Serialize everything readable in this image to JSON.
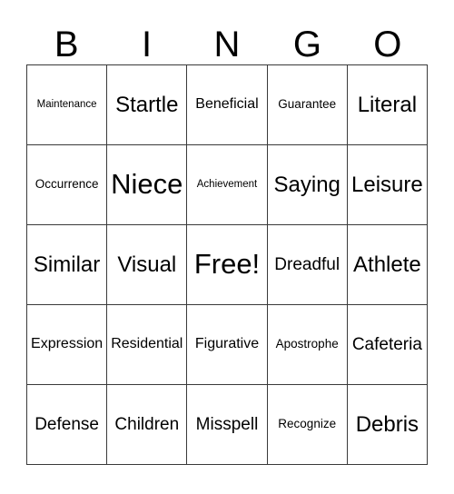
{
  "card": {
    "headers": [
      "B",
      "I",
      "N",
      "G",
      "O"
    ],
    "free_space_label": "Free!",
    "rows": [
      [
        {
          "label": "Maintenance",
          "size": "sz-xs"
        },
        {
          "label": "Startle",
          "size": "sz-xl"
        },
        {
          "label": "Beneficial",
          "size": "sz-m"
        },
        {
          "label": "Guarantee",
          "size": "sz-s"
        },
        {
          "label": "Literal",
          "size": "sz-xl"
        }
      ],
      [
        {
          "label": "Occurrence",
          "size": "sz-s"
        },
        {
          "label": "Niece",
          "size": "sz-xxl"
        },
        {
          "label": "Achievement",
          "size": "sz-xs"
        },
        {
          "label": "Saying",
          "size": "sz-xl"
        },
        {
          "label": "Leisure",
          "size": "sz-xl"
        }
      ],
      [
        {
          "label": "Similar",
          "size": "sz-xl"
        },
        {
          "label": "Visual",
          "size": "sz-xl"
        },
        {
          "label": "Free!",
          "size": "sz-xxl"
        },
        {
          "label": "Dreadful",
          "size": "sz-l"
        },
        {
          "label": "Athlete",
          "size": "sz-xl"
        }
      ],
      [
        {
          "label": "Expression",
          "size": "sz-m"
        },
        {
          "label": "Residential",
          "size": "sz-m"
        },
        {
          "label": "Figurative",
          "size": "sz-m"
        },
        {
          "label": "Apostrophe",
          "size": "sz-s"
        },
        {
          "label": "Cafeteria",
          "size": "sz-l"
        }
      ],
      [
        {
          "label": "Defense",
          "size": "sz-l"
        },
        {
          "label": "Children",
          "size": "sz-l"
        },
        {
          "label": "Misspell",
          "size": "sz-l"
        },
        {
          "label": "Recognize",
          "size": "sz-s"
        },
        {
          "label": "Debris",
          "size": "sz-xl"
        }
      ]
    ]
  },
  "colors": {
    "grid_line": "#3a3a3a",
    "text": "#000000",
    "background": "#ffffff"
  }
}
